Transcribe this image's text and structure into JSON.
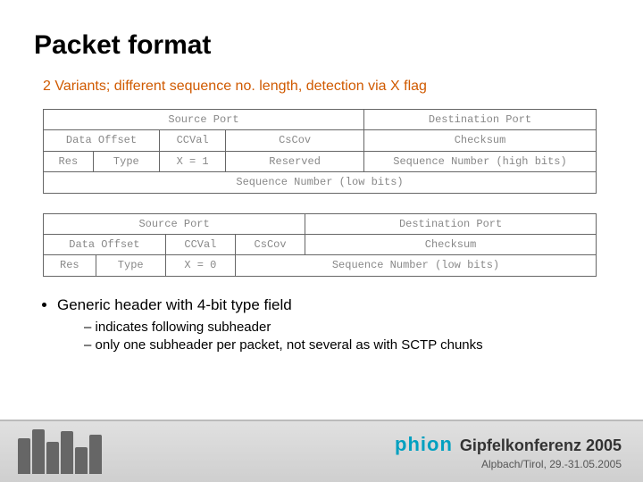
{
  "title": "Packet format",
  "subtitle": "2 Variants; different sequence no. length, detection via X flag",
  "packet1": {
    "source_port": "Source Port",
    "dest_port": "Destination Port",
    "data_offset": "Data Offset",
    "ccval": "CCVal",
    "cscov": "CsCov",
    "checksum": "Checksum",
    "res": "Res",
    "type": "Type",
    "xflag": "X = 1",
    "reserved": "Reserved",
    "seq_high": "Sequence Number (high bits)",
    "seq_low": "Sequence Number (low bits)"
  },
  "packet2": {
    "source_port": "Source Port",
    "dest_port": "Destination Port",
    "data_offset": "Data Offset",
    "ccval": "CCVal",
    "cscov": "CsCov",
    "checksum": "Checksum",
    "res": "Res",
    "type": "Type",
    "xflag": "X = 0",
    "seq_low": "Sequence Number (low bits)"
  },
  "bullet_main": "Generic header with 4-bit type field",
  "bullet_sub1": "indicates following subheader",
  "bullet_sub2": "only one subheader per packet, not several as with SCTP chunks",
  "footer": {
    "brand1": "phion",
    "brand2": "Gipfelkonferenz 2005",
    "sub": "Alpbach/Tirol, 29.-31.05.2005"
  }
}
